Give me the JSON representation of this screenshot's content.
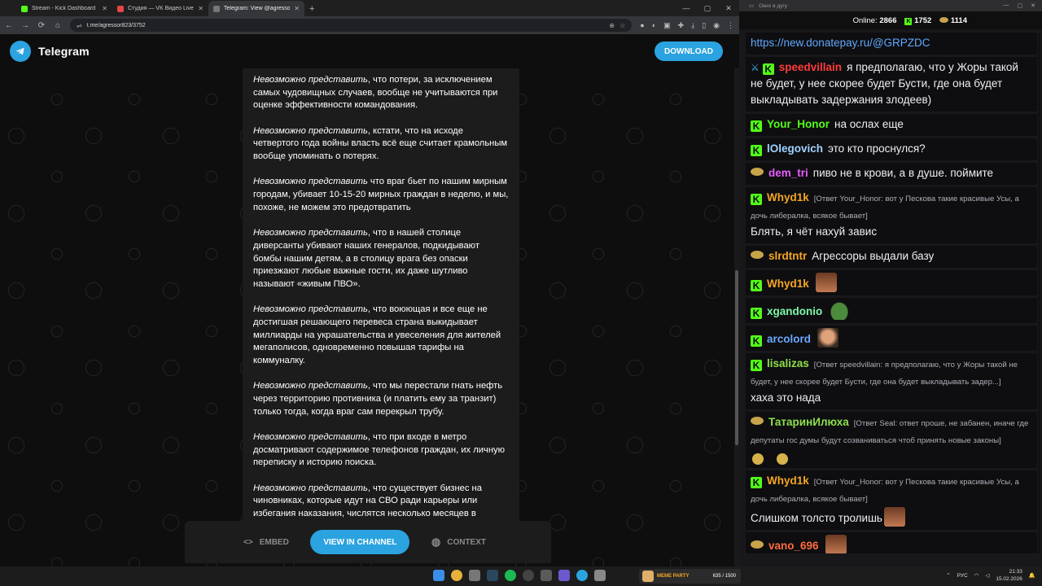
{
  "browser": {
    "tabs": [
      {
        "title": "Stream - Kick Dashboard",
        "color": "#53fc18"
      },
      {
        "title": "Студия — VK Видео Live",
        "color": "#e64646"
      },
      {
        "title": "Telegram: View @agressor823",
        "color": "#777777"
      }
    ],
    "url": "t.me/agressor823/3752"
  },
  "telegram": {
    "brand": "Telegram",
    "download_label": "DOWNLOAD",
    "paragraphs": [
      {
        "em": "Невозможно представить",
        "text": ", что потери, за исключением самых чудовищных случаев, вообще не учитываются при оценке эффективности командования."
      },
      {
        "em": "Невозможно представить",
        "text": ", кстати, что на исходе четвертого года войны власть всё еще считает крамольным вообще упоминать о потерях."
      },
      {
        "em": "Невозможно представить",
        "text": " что враг бьет по нашим мирным городам, убивает 10-15-20 мирных граждан в неделю, и мы, похоже, не можем это предотвратить"
      },
      {
        "em": "Невозможно представить",
        "text": ", что в нашей столице диверсанты убивают наших генералов, подкидывают бомбы нашим детям, а в столицу врага без опаски приезжают любые важные гости, их даже шутливо называют «живым ПВО»."
      },
      {
        "em": "Невозможно представить",
        "text": ", что воюющая и все еще не достигшая решающего перевеса страна выкидывает миллиарды на украшательства и увеселения для жителей мегаполисов, одновременно повышая тарифы на коммуналку."
      },
      {
        "em": "Невозможно представить",
        "text": ", что мы перестали гнать нефть через территорию противника (и платить ему за транзит) только тогда, когда враг сам перекрыл трубу."
      },
      {
        "em": "Невозможно представить",
        "text": ", что при входе в метро досматривают содержимое телефонов граждан, их личную переписку и историю поиска."
      },
      {
        "em": "Невозможно представить",
        "text": ", что существует бизнес на чиновниках, которые идут на СВО ради карьеры или избегания наказания, числятся несколько месяцев в"
      }
    ],
    "embed_label": "EMBED",
    "view_label": "VIEW IN CHANNEL",
    "context_label": "CONTEXT"
  },
  "chat": {
    "window_title": "Окно в дугу",
    "online_label": "Online:",
    "online_count": "2866",
    "kick_count": "1752",
    "coin_count": "1114",
    "messages": [
      {
        "user": "",
        "color": "#5fa8ff",
        "reply": "",
        "text": "https://new.donatepay.ru/@GRPZDC",
        "badges": []
      },
      {
        "user": "speedvillain",
        "color": "#ff3b3b",
        "reply": "",
        "text": "я предполагаю, что у Жоры такой не будет, у нее скорее будет Бусти, где она будет выкладывать задержания злодеев)",
        "badges": [
          "sword",
          "k"
        ]
      },
      {
        "user": "Your_Honor",
        "color": "#53fc18",
        "reply": "",
        "text": "на ослах еще",
        "badges": [
          "k"
        ]
      },
      {
        "user": "lOlegovich",
        "color": "#9fd3ff",
        "reply": "",
        "text": "это кто проснулся?",
        "badges": [
          "k"
        ]
      },
      {
        "user": "dem_tri",
        "color": "#e85cff",
        "reply": "",
        "text": "пиво не в крови, а в душе. поймите",
        "badges": [
          "sub"
        ]
      },
      {
        "user": "Whyd1k",
        "color": "#f5a623",
        "reply": "[Ответ Your_Honor: вот у Пескова такие красивые Усы, а дочь либералка, всякое бывает]",
        "text": "Блять, я чёт нахуй завис",
        "badges": [
          "k"
        ]
      },
      {
        "user": "slrdtntr",
        "color": "#f5a623",
        "reply": "",
        "text": "Агрессоры выдали базу",
        "badges": [
          "sub"
        ]
      },
      {
        "user": "Whyd1k",
        "color": "#f5a623",
        "reply": "",
        "text": "",
        "emote": "face",
        "badges": [
          "k"
        ]
      },
      {
        "user": "xgandonio",
        "color": "#7df9a8",
        "reply": "",
        "text": "",
        "emote": "frog",
        "badges": [
          "k"
        ]
      },
      {
        "user": "arcolord",
        "color": "#6ba7ff",
        "reply": "",
        "text": "",
        "emote": "bald",
        "badges": [
          "k"
        ]
      },
      {
        "user": "lisalizas",
        "color": "#8ee04c",
        "reply": "[Ответ speedvillain: я предполагаю, что у Жоры такой не будет, у нее скорее будет Бусти, где она будет выкладывать задер...]",
        "text": "хаха это нада",
        "badges": [
          "k"
        ]
      },
      {
        "user": "ТатаринИлюха",
        "color": "#8ee04c",
        "reply": "[Ответ Seal: ответ проше, не забанен, иначе где депутаты гос думы будут созваниваться чтоб принять новые законы]",
        "text": "",
        "emote": "gold2",
        "badges": [
          "sub"
        ]
      },
      {
        "user": "Whyd1k",
        "color": "#f5a623",
        "reply": "[Ответ Your_Honor: вот у Пескова такие красивые Усы, а дочь либералка, всякое бывает]",
        "text": "Слишком толсто тролишь",
        "emote": "face",
        "badges": [
          "k"
        ]
      },
      {
        "user": "vano_696",
        "color": "#ff6a3d",
        "reply": "",
        "text": "",
        "emote": "face",
        "badges": [
          "sub"
        ]
      }
    ]
  },
  "taskbar": {
    "widget_title": "MEME PARTY",
    "widget_progress": "635 / 1500",
    "lang": "РУС",
    "time": "21:33",
    "date": "15.02.2026"
  }
}
